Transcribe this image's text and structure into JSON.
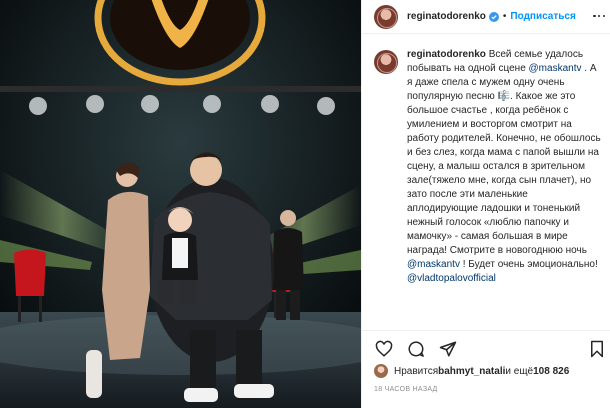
{
  "header": {
    "username": "reginatodorenko",
    "separator": "•",
    "follow_label": "Подписаться"
  },
  "caption": {
    "username": "reginatodorenko",
    "parts": [
      "Всей семье удалось побывать на одной сцене ",
      "@maskantv",
      " . А я даже спела с мужем одну очень популярную песню ",
      "🎼",
      ". Какое же это большое счастье , когда ребёнок с умилением и восторгом смотрит на работу родителей. Конечно, не обошлось и без слез, когда мама с папой вышли на сцену, а малыш остался в зрительном зале(тяжело мне, когда сын плачет), но зато после эти маленькие аплодирующие ладошки и тоненький нежный голосок «люблю папочку и мамочку» - самая большая в мире награда! Смотрите в новогоднюю ночь ",
      "@maskantv",
      " ! Будет очень эмоционально! ",
      "@vladtopalovofficial"
    ]
  },
  "likes": {
    "prefix": "Нравится ",
    "user": "bahmyt_natali",
    "middle": " и ещё ",
    "count": "108 826"
  },
  "timestamp": "18 ЧАСОВ НАЗАД",
  "icons": {
    "like": "heart-icon",
    "comment": "comment-icon",
    "share": "share-icon",
    "save": "bookmark-icon",
    "more": "more-options-icon",
    "verified": "verified-badge-icon"
  },
  "colors": {
    "follow": "#0095f6",
    "mention": "#00376b",
    "verified": "#3897f0",
    "muted": "#8e8e8e",
    "stage_gold": "#e3a43a",
    "spot_green": "#b9f26a"
  }
}
